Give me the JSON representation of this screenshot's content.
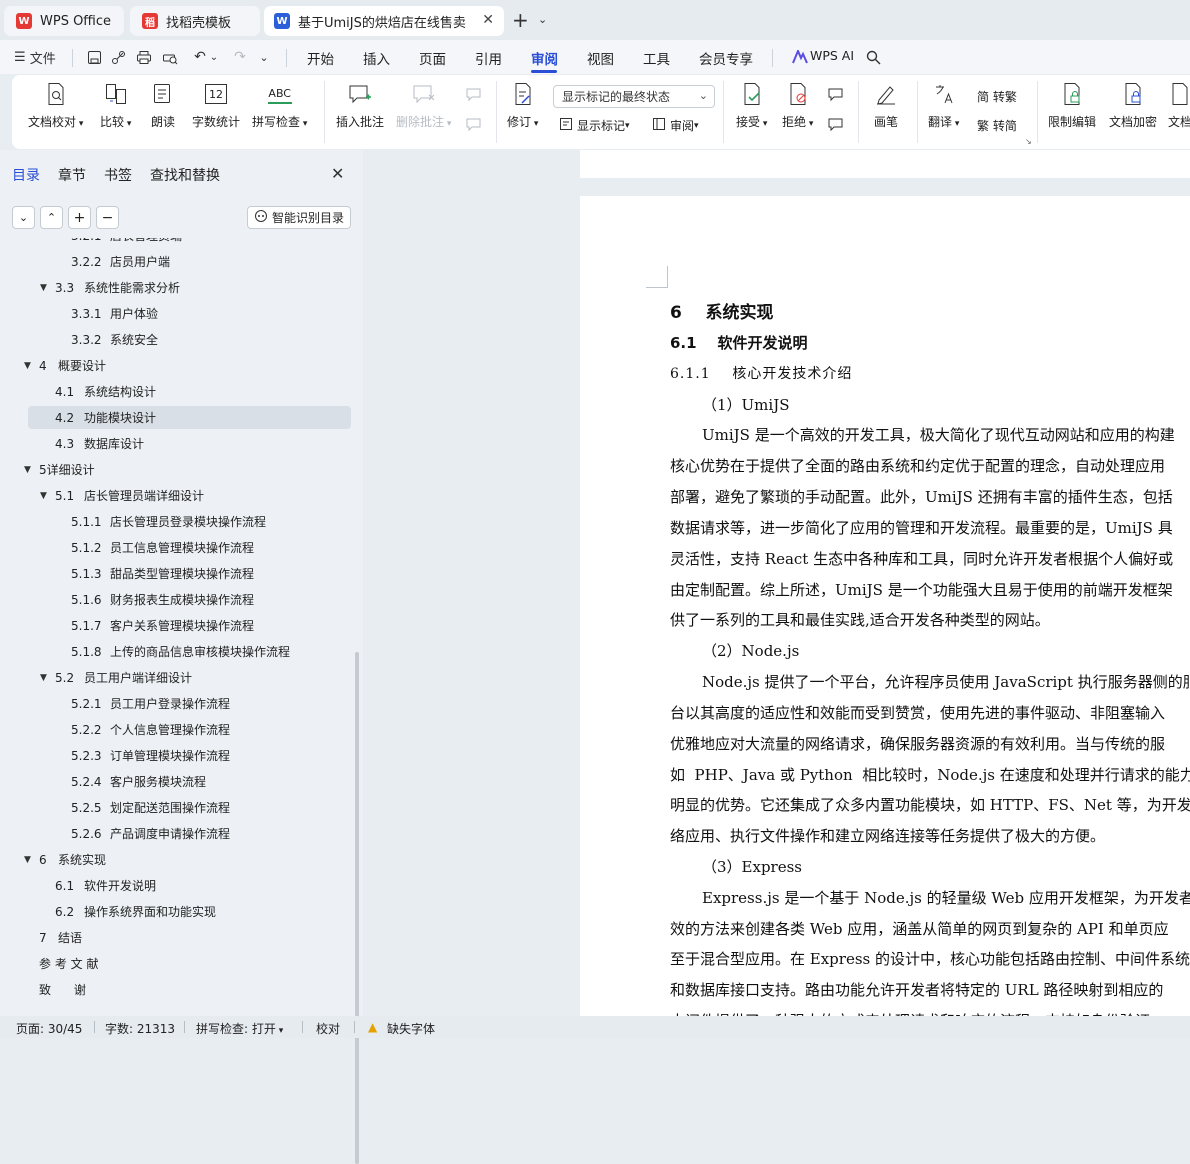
{
  "tabs": {
    "wps_office": "WPS Office",
    "template_tab": "找稻壳模板",
    "document_tab": "基于UmiJS的烘焙店在线售卖"
  },
  "menubar": {
    "file": "文件",
    "items": [
      "开始",
      "插入",
      "页面",
      "引用",
      "审阅",
      "视图",
      "工具",
      "会员专享"
    ],
    "ai": "WPS AI"
  },
  "ribbon": {
    "doc_proof": "文档校对",
    "compare": "比较",
    "read_aloud": "朗读",
    "word_count": "字数统计",
    "spell_check": "拼写检查",
    "spell_check_icon_text": "ABC",
    "word_count_icon_text": "12",
    "insert_comment": "插入批注",
    "delete_comment": "删除批注",
    "track_changes": "修订",
    "markup_select": "显示标记的最终状态",
    "show_markup": "显示标记",
    "review_pane": "审阅",
    "accept": "接受",
    "reject": "拒绝",
    "ink": "画笔",
    "translate": "翻译",
    "to_traditional": "简 转繁",
    "to_simplified": "繁 转简",
    "restrict_editing": "限制编辑",
    "encrypt": "文档加密",
    "doc_more": "文档"
  },
  "panel": {
    "tabs": [
      "目录",
      "章节",
      "书签",
      "查找和替换"
    ],
    "smart_toc": "智能识别目录",
    "toc": [
      {
        "num": "3.2.1",
        "title": "店长管理员端",
        "level": 3,
        "arrow": false
      },
      {
        "num": "3.2.2",
        "title": "店员用户端",
        "level": 3,
        "arrow": false
      },
      {
        "num": "3.3",
        "title": "系统性能需求分析",
        "level": 2,
        "arrow": true
      },
      {
        "num": "3.3.1",
        "title": "用户体验",
        "level": 3,
        "arrow": false
      },
      {
        "num": "3.3.2",
        "title": "系统安全",
        "level": 3,
        "arrow": false
      },
      {
        "num": "4",
        "title": "概要设计",
        "level": 1,
        "arrow": true
      },
      {
        "num": "4.1",
        "title": "系统结构设计",
        "level": 2,
        "arrow": false
      },
      {
        "num": "4.2",
        "title": "功能模块设计",
        "level": 2,
        "arrow": false,
        "selected": true
      },
      {
        "num": "4.3",
        "title": "数据库设计",
        "level": 2,
        "arrow": false
      },
      {
        "num": "5详细设计",
        "title": "",
        "level": 1,
        "arrow": true
      },
      {
        "num": "5.1",
        "title": "店长管理员端详细设计",
        "level": 2,
        "arrow": true
      },
      {
        "num": "5.1.1",
        "title": "店长管理员登录模块操作流程",
        "level": 3,
        "arrow": false
      },
      {
        "num": "5.1.2",
        "title": "员工信息管理模块操作流程",
        "level": 3,
        "arrow": false
      },
      {
        "num": "5.1.3",
        "title": "甜品类型管理模块操作流程",
        "level": 3,
        "arrow": false
      },
      {
        "num": "5.1.6",
        "title": "财务报表生成模块操作流程",
        "level": 3,
        "arrow": false
      },
      {
        "num": "5.1.7",
        "title": "客户关系管理模块操作流程",
        "level": 3,
        "arrow": false
      },
      {
        "num": "5.1.8",
        "title": "上传的商品信息审核模块操作流程",
        "level": 3,
        "arrow": false
      },
      {
        "num": "5.2",
        "title": "员工用户端详细设计",
        "level": 2,
        "arrow": true
      },
      {
        "num": "5.2.1",
        "title": "员工用户登录操作流程",
        "level": 3,
        "arrow": false
      },
      {
        "num": "5.2.2",
        "title": "个人信息管理操作流程",
        "level": 3,
        "arrow": false
      },
      {
        "num": "5.2.3",
        "title": "订单管理模块操作流程",
        "level": 3,
        "arrow": false
      },
      {
        "num": "5.2.4",
        "title": "客户服务模块流程",
        "level": 3,
        "arrow": false
      },
      {
        "num": "5.2.5",
        "title": "划定配送范围操作流程",
        "level": 3,
        "arrow": false
      },
      {
        "num": "5.2.6",
        "title": "产品调度申请操作流程",
        "level": 3,
        "arrow": false
      },
      {
        "num": "6",
        "title": "系统实现",
        "level": 1,
        "arrow": true
      },
      {
        "num": "6.1",
        "title": "软件开发说明",
        "level": 2,
        "arrow": false
      },
      {
        "num": "6.2",
        "title": "操作系统界面和功能实现",
        "level": 2,
        "arrow": false
      },
      {
        "num": "7",
        "title": "结语",
        "level": 1,
        "arrow": false
      },
      {
        "num": "参 考 文 献",
        "title": "",
        "level": 1,
        "arrow": false
      },
      {
        "num": "致      谢",
        "title": "",
        "level": 1,
        "arrow": false
      }
    ]
  },
  "document": {
    "lines": [
      {
        "text": "6    系统实现",
        "style": "h1",
        "indent": false
      },
      {
        "text": "6.1    软件开发说明",
        "style": "h2",
        "indent": false
      },
      {
        "text": "6.1.1    核心开发技术介绍",
        "style": "h3",
        "indent": false
      },
      {
        "text": "（1）UmiJS",
        "style": "body",
        "indent": true
      },
      {
        "text": "UmiJS 是一个高效的开发工具，极大简化了现代互动网站和应用的构建",
        "style": "body",
        "indent": true
      },
      {
        "text": "核心优势在于提供了全面的路由系统和约定优于配置的理念，自动处理应用",
        "style": "body",
        "indent": false
      },
      {
        "text": "部署，避免了繁琐的手动配置。此外，UmiJS 还拥有丰富的插件生态，包括",
        "style": "body",
        "indent": false
      },
      {
        "text": "数据请求等，进一步简化了应用的管理和开发流程。最重要的是，UmiJS 具",
        "style": "body",
        "indent": false
      },
      {
        "text": "灵活性，支持 React 生态中各种库和工具，同时允许开发者根据个人偏好或",
        "style": "body",
        "indent": false
      },
      {
        "text": "由定制配置。综上所述，UmiJS 是一个功能强大且易于使用的前端开发框架",
        "style": "body",
        "indent": false
      },
      {
        "text": "供了一系列的工具和最佳实践,适合开发各种类型的网站。",
        "style": "body",
        "indent": false
      },
      {
        "text": "（2）Node.js",
        "style": "body",
        "indent": true
      },
      {
        "text": "Node.js 提供了一个平台，允许程序员使用 JavaScript 执行服务器侧的服",
        "style": "body",
        "indent": true
      },
      {
        "text": "台以其高度的适应性和效能而受到赞赏，使用先进的事件驱动、非阻塞输入",
        "style": "body",
        "indent": false
      },
      {
        "text": "优雅地应对大流量的网络请求，确保服务器资源的有效利用。当与传统的服",
        "style": "body",
        "indent": false
      },
      {
        "text": "如  PHP、Java 或 Python  相比较时，Node.js 在速度和处理并行请求的能力上",
        "style": "body",
        "indent": false
      },
      {
        "text": "明显的优势。它还集成了众多内置功能模块，如 HTTP、FS、Net 等，为开发",
        "style": "body",
        "indent": false
      },
      {
        "text": "络应用、执行文件操作和建立网络连接等任务提供了极大的方便。",
        "style": "body",
        "indent": false
      },
      {
        "text": "（3）Express",
        "style": "body",
        "indent": true
      },
      {
        "text": "Express.js 是一个基于 Node.js 的轻量级 Web 应用开发框架，为开发者提",
        "style": "body",
        "indent": true
      },
      {
        "text": "效的方法来创建各类 Web 应用，涵盖从简单的网页到复杂的 API 和单页应",
        "style": "body",
        "indent": false
      },
      {
        "text": "至于混合型应用。在 Express 的设计中，核心功能包括路由控制、中间件系统",
        "style": "body",
        "indent": false
      },
      {
        "text": "和数据库接口支持。路由功能允许开发者将特定的 URL 路径映射到相应的",
        "style": "body",
        "indent": false
      },
      {
        "text": "中间件提供了一种强大的方式来处理请求和响应的流程，支持如身份验证、",
        "style": "body",
        "indent": false
      }
    ]
  },
  "statusbar": {
    "page": "页面: 30/45",
    "words": "字数: 21313",
    "spell": "拼写检查: 打开",
    "proof": "校对",
    "missing_font": "缺失字体"
  },
  "colors": {
    "accent": "#2a4fd6",
    "wps_red": "#e53935",
    "doc_blue": "#2b5fd9"
  }
}
